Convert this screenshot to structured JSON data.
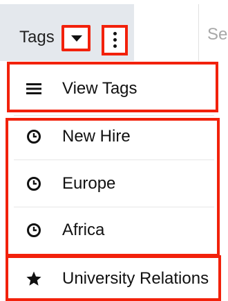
{
  "nav": {
    "tab_label": "Tags",
    "search_peek": "Se"
  },
  "menu": {
    "view_tags": "View Tags",
    "recent": [
      {
        "label": "New Hire",
        "icon": "clock-icon"
      },
      {
        "label": "Europe",
        "icon": "clock-icon"
      },
      {
        "label": "Africa",
        "icon": "clock-icon"
      }
    ],
    "favorites": [
      {
        "label": "University Relations",
        "icon": "star-icon"
      }
    ]
  },
  "colors": {
    "highlight": "#f2210b",
    "tab_bg": "#e4e8ed",
    "link_underline": "#1a3bff"
  }
}
